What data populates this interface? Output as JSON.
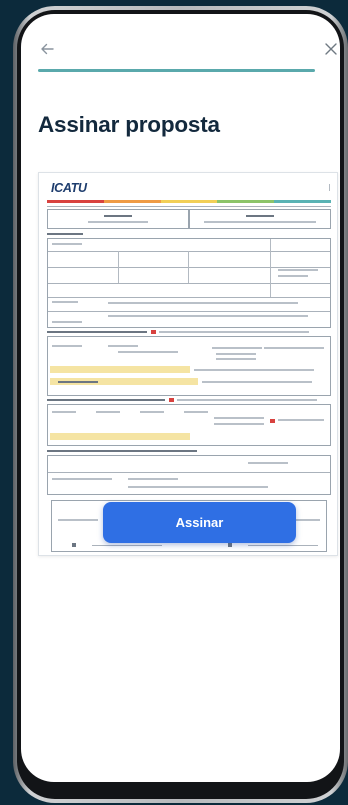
{
  "header": {
    "back_icon": "arrow-left-icon",
    "close_icon": "close-icon",
    "progress": 1.0
  },
  "page": {
    "title": "Assinar proposta"
  },
  "document": {
    "logo_text": "ICATU",
    "stripe_colors": [
      "#d8423f",
      "#ef9b45",
      "#f2cf57",
      "#8cc46a",
      "#5ab3b4"
    ]
  },
  "actions": {
    "sign_label": "Assinar"
  },
  "colors": {
    "background": "#0c2a3b",
    "accent_teal": "#5aa9ac",
    "button_blue": "#2f6fe4",
    "title": "#13293d",
    "highlight": "#f5e4a3"
  }
}
